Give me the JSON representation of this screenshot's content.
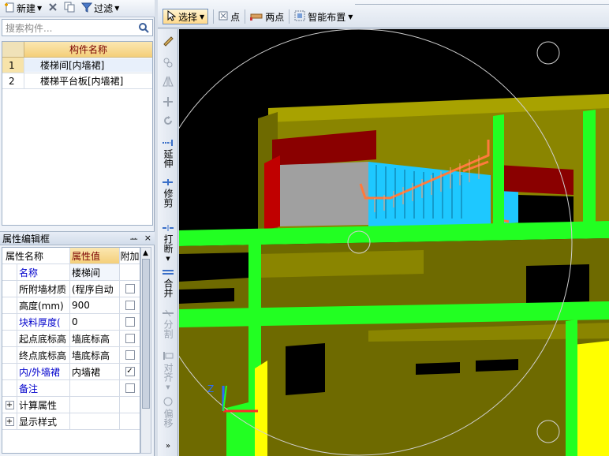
{
  "toolbar_left": {
    "new_label": "新建",
    "filter_label": "过滤"
  },
  "search": {
    "placeholder": "搜索构件..."
  },
  "component_list": {
    "header": "构件名称",
    "rows": [
      {
        "index": "1",
        "name": "楼梯间[内墙裙]",
        "selected": true
      },
      {
        "index": "2",
        "name": "楼梯平台板[内墙裙]",
        "selected": false
      }
    ]
  },
  "property_panel": {
    "title": "属性编辑框",
    "pin_glyph": "ᅭ",
    "close_glyph": "×",
    "headers": {
      "name": "属性名称",
      "value": "属性值",
      "extra": "附加"
    },
    "rows": [
      {
        "name": "名称",
        "value": "楼梯间",
        "name_blue": true,
        "check": "none"
      },
      {
        "name": "所附墙材质",
        "value": "(程序自动",
        "name_blue": false,
        "check": "empty"
      },
      {
        "name": "高度(mm)",
        "value": "900",
        "name_blue": false,
        "check": "empty"
      },
      {
        "name": "块料厚度(",
        "value": "0",
        "name_blue": true,
        "check": "empty"
      },
      {
        "name": "起点底标高",
        "value": "墙底标高",
        "name_blue": false,
        "check": "empty"
      },
      {
        "name": "终点底标高",
        "value": "墙底标高",
        "name_blue": false,
        "check": "empty"
      },
      {
        "name": "内/外墙裙",
        "value": "内墙裙",
        "name_blue": true,
        "check": "checked"
      },
      {
        "name": "备注",
        "value": "",
        "name_blue": true,
        "check": "empty"
      },
      {
        "name": "计算属性",
        "value": "",
        "name_blue": false,
        "check": "none",
        "expand": true
      },
      {
        "name": "显示样式",
        "value": "",
        "name_blue": false,
        "check": "none",
        "expand": true
      }
    ]
  },
  "toolbar_right": {
    "select_label": "选择",
    "point_label": "点",
    "two_point_label": "两点",
    "smart_label": "智能布置"
  },
  "vertical_toolbar": {
    "extend": "延伸",
    "trim": "修剪",
    "break": "打断",
    "merge": "合并",
    "split": "分割",
    "align": "对齐",
    "offset": "偏移"
  },
  "viewport": {
    "axis_z": "Z",
    "colors": {
      "background": "#000000",
      "beam_green": "#22ff22",
      "wall_olive": "#8a8500",
      "wall_dark": "#5e5b00",
      "stair_cyan": "#1ec8ff",
      "brick_red": "#b80000",
      "slab_gray": "#a0a0a0",
      "yellow": "#ffff00",
      "orange": "#ff7a3c"
    }
  }
}
